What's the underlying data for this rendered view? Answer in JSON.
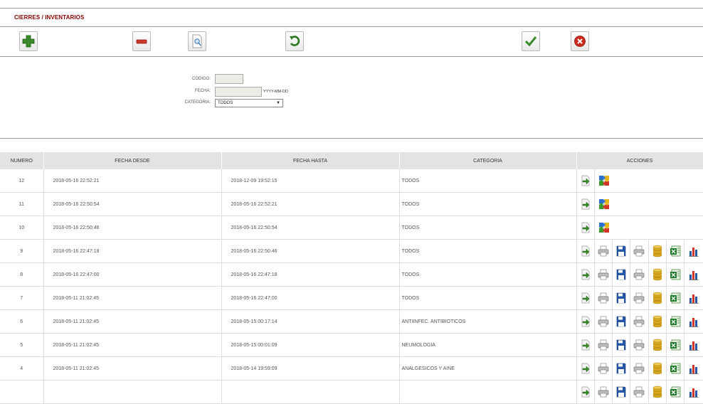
{
  "header": {
    "title": "CIERRES / INVENTARIOS"
  },
  "toolbar": {
    "icons": [
      "add-icon",
      "remove-icon",
      "search-document-icon",
      "refresh-icon",
      "accept-check-icon",
      "cancel-icon"
    ],
    "colors": {
      "green": "#3a8a2a",
      "red": "#cc2a1e"
    }
  },
  "form": {
    "codigo_label": "CODIGO:",
    "codigo_value": "",
    "fecha_label": "FECHA:",
    "fecha_value": "",
    "fecha_hint": "YYYY-MM-DD",
    "categoria_label": "CATEGORIA:",
    "categoria_value": "TODOS"
  },
  "table": {
    "columns": [
      "NUMERO",
      "FECHA DESDE",
      "FECHA HASTA",
      "CATEGORIA",
      "ACCIONES"
    ],
    "rows": [
      {
        "numero": "12",
        "desde": "2018-05-16 22:52:21",
        "hasta": "2018-12-09 19:52:15",
        "categoria": "TODOS",
        "actions": [
          "go-arrow-icon",
          "puzzle-icon"
        ]
      },
      {
        "numero": "11",
        "desde": "2018-05-16 22:50:54",
        "hasta": "2018-05-16 22:52:21",
        "categoria": "TODOS",
        "actions": [
          "go-arrow-icon",
          "puzzle-icon"
        ]
      },
      {
        "numero": "10",
        "desde": "2018-05-16 22:50:46",
        "hasta": "2018-05-16 22:50:54",
        "categoria": "TODOS",
        "actions": [
          "go-arrow-icon",
          "puzzle-icon"
        ]
      },
      {
        "numero": "9",
        "desde": "2018-05-16 22:47:18",
        "hasta": "2018-05-16 22:50:46",
        "categoria": "TODOS",
        "actions": [
          "go-arrow-icon",
          "printer-icon",
          "save-disk-icon",
          "printer-icon",
          "database-icon",
          "excel-icon",
          "bar-chart-icon"
        ]
      },
      {
        "numero": "8",
        "desde": "2018-05-16 22:47:00",
        "hasta": "2018-05-16 22:47:18",
        "categoria": "TODOS",
        "actions": [
          "go-arrow-icon",
          "printer-icon",
          "save-disk-icon",
          "printer-icon",
          "database-icon",
          "excel-icon",
          "bar-chart-icon"
        ]
      },
      {
        "numero": "7",
        "desde": "2018-05-11 21:02:45",
        "hasta": "2018-05-16 22:47:00",
        "categoria": "TODOS",
        "actions": [
          "go-arrow-icon",
          "printer-icon",
          "save-disk-icon",
          "printer-icon",
          "database-icon",
          "excel-icon",
          "bar-chart-icon"
        ]
      },
      {
        "numero": "6",
        "desde": "2018-05-11 21:02:45",
        "hasta": "2018-05-15 00:17:14",
        "categoria": "ANTIINFEC. ANTIBIOTICOS",
        "actions": [
          "go-arrow-icon",
          "printer-icon",
          "save-disk-icon",
          "printer-icon",
          "database-icon",
          "excel-icon",
          "bar-chart-icon"
        ]
      },
      {
        "numero": "5",
        "desde": "2018-05-11 21:02:45",
        "hasta": "2018-05-15 00:01:09",
        "categoria": "NEUMOLOGIA",
        "actions": [
          "go-arrow-icon",
          "printer-icon",
          "save-disk-icon",
          "printer-icon",
          "database-icon",
          "excel-icon",
          "bar-chart-icon"
        ]
      },
      {
        "numero": "4",
        "desde": "2018-05-11 21:02:45",
        "hasta": "2018-05-14 19:59:09",
        "categoria": "ANALGESICOS Y AINE",
        "actions": [
          "go-arrow-icon",
          "printer-icon",
          "save-disk-icon",
          "printer-icon",
          "database-icon",
          "excel-icon",
          "bar-chart-icon"
        ]
      },
      {
        "numero": "",
        "desde": "",
        "hasta": "",
        "categoria": "",
        "actions": [
          "go-arrow-icon",
          "printer-icon",
          "save-disk-icon",
          "printer-icon",
          "database-icon",
          "excel-icon",
          "bar-chart-icon"
        ]
      }
    ]
  }
}
